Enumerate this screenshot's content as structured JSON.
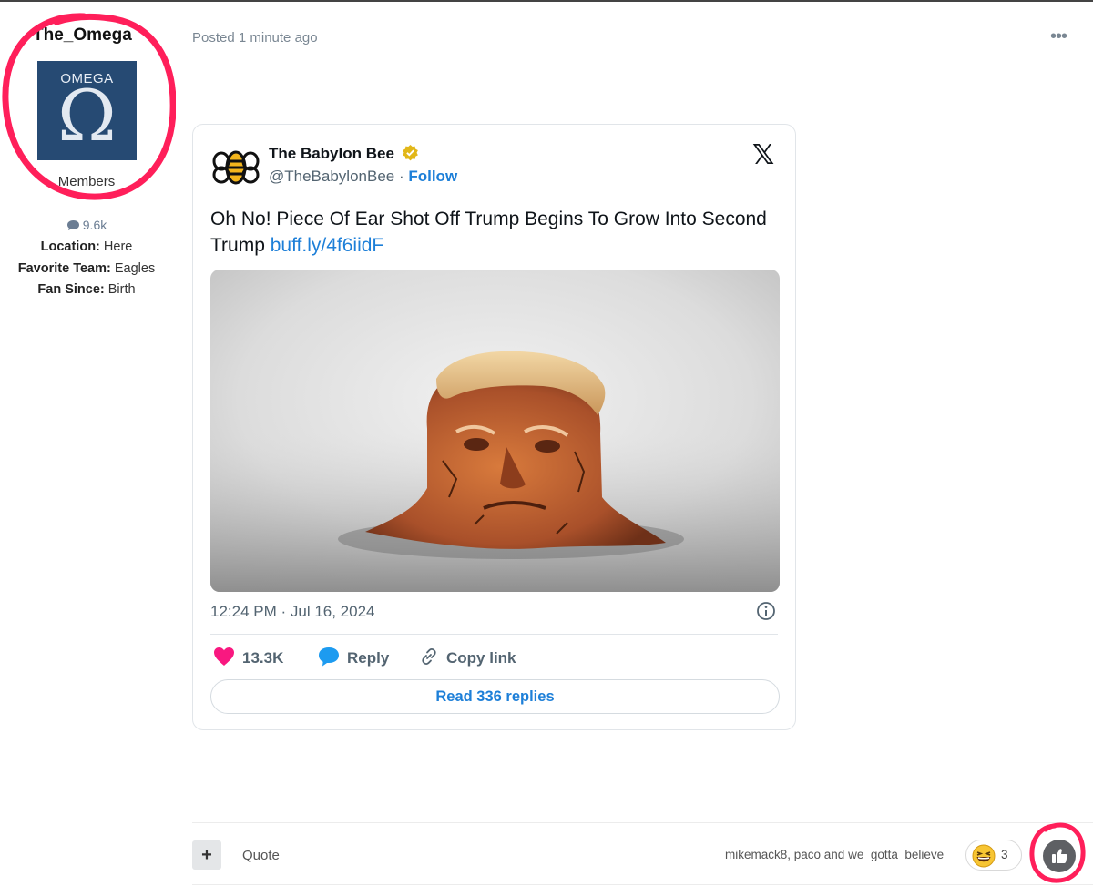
{
  "author": {
    "name": "The_Omega",
    "avatar_text": "OMEGA",
    "avatar_glyph": "Ω",
    "group": "Members",
    "post_count": "9.6k",
    "fields": [
      {
        "label": "Location:",
        "value": "Here"
      },
      {
        "label": "Favorite Team:",
        "value": "Eagles"
      },
      {
        "label": "Fan Since:",
        "value": "Birth"
      }
    ]
  },
  "post": {
    "posted": "Posted 1 minute ago",
    "menu": "•••"
  },
  "tweet": {
    "name": "The Babylon Bee",
    "handle": "@TheBabylonBee",
    "separator": " · ",
    "follow": "Follow",
    "platform_icon": "𝕏",
    "text": "Oh No! Piece Of Ear Shot Off Trump Begins To Grow Into Second Trump ",
    "link": "buff.ly/4f6iidF",
    "timestamp": "12:24 PM · Jul 16, 2024",
    "likes": "13.3K",
    "reply": "Reply",
    "copy_link": "Copy link",
    "read_replies": "Read 336 replies"
  },
  "footer": {
    "plus": "+",
    "quote": "Quote",
    "reactors": "mikemack8, paco and we_gotta_believe",
    "reaction_count": "3"
  },
  "colors": {
    "avatar_bg": "#264a73",
    "link": "#1d7fd8",
    "heart": "#f91880",
    "reply_bubble": "#1d9bf0",
    "highlight_ring": "#ff1f5a",
    "verified": "#e2b719"
  }
}
